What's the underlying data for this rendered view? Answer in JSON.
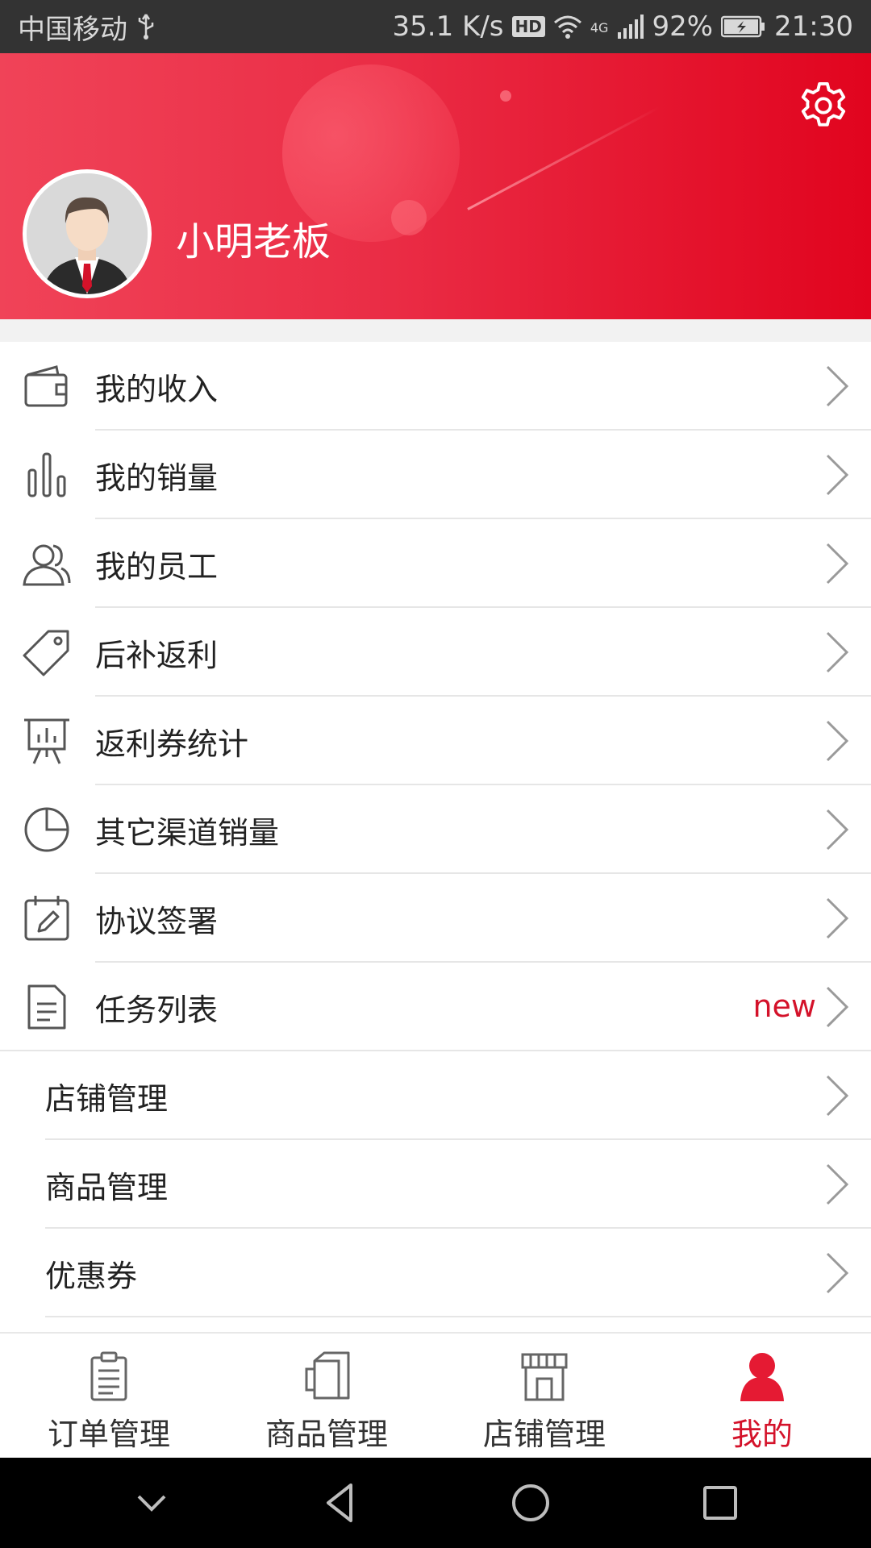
{
  "status_bar": {
    "carrier": "中国移动",
    "usb_icon": "usb-icon",
    "net_speed": "35.1 K/s",
    "hd": "HD",
    "network_type": "4G",
    "battery": "92%",
    "time": "21:30"
  },
  "header": {
    "user_name": "小明老板",
    "settings_icon": "gear-icon",
    "gradient": [
      "#f04358",
      "#e1041e"
    ]
  },
  "menu": {
    "items": [
      {
        "label": "我的收入",
        "icon": "wallet-icon"
      },
      {
        "label": "我的销量",
        "icon": "bar-chart-icon"
      },
      {
        "label": "我的员工",
        "icon": "people-icon"
      },
      {
        "label": "后补返利",
        "icon": "tag-icon"
      },
      {
        "label": "返利券统计",
        "icon": "presentation-board-icon"
      },
      {
        "label": "其它渠道销量",
        "icon": "pie-chart-icon"
      },
      {
        "label": "协议签署",
        "icon": "calendar-edit-icon"
      },
      {
        "label": "任务列表",
        "icon": "document-icon",
        "badge": "new"
      },
      {
        "label": "店铺管理"
      },
      {
        "label": "商品管理"
      },
      {
        "label": "优惠券"
      }
    ]
  },
  "tabbar": {
    "tabs": [
      {
        "label": "订单管理",
        "icon": "clipboard-icon",
        "active": false
      },
      {
        "label": "商品管理",
        "icon": "box-icon",
        "active": false
      },
      {
        "label": "店铺管理",
        "icon": "store-icon",
        "active": false
      },
      {
        "label": "我的",
        "icon": "person-icon",
        "active": true
      }
    ]
  },
  "colors": {
    "accent": "#d4122a",
    "status_bar_bg": "#333333",
    "nav_bar_bg": "#000000"
  }
}
